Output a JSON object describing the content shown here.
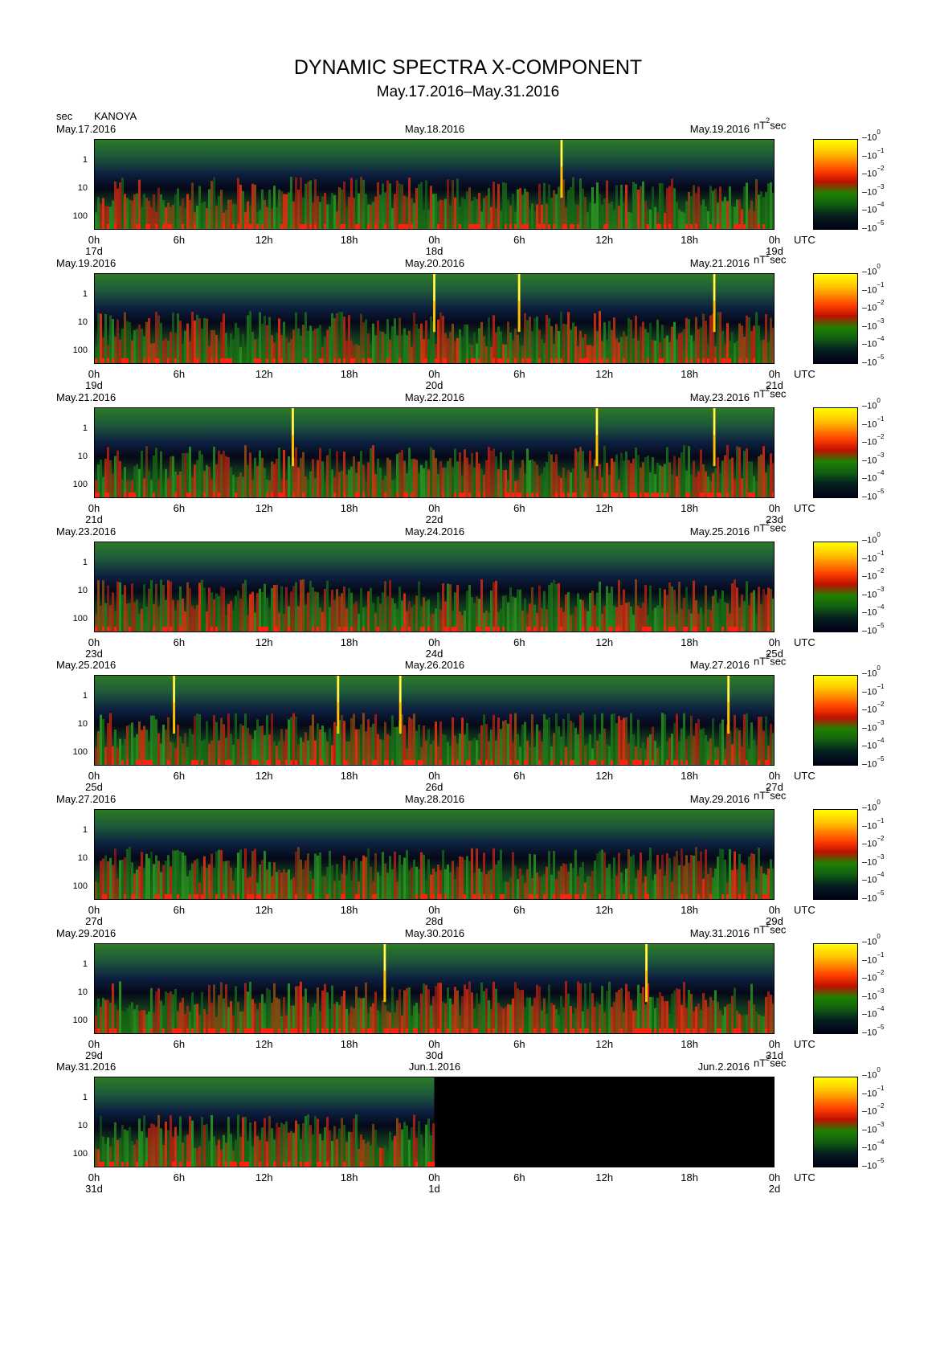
{
  "chart_data": {
    "type": "heatmap",
    "title": "DYNAMIC SPECTRA X-COMPONENT",
    "subtitle": "May.17.2016–May.31.2016",
    "station": "KANOYA",
    "y_unit": "sec",
    "y_ticks": [
      "1",
      "10",
      "100"
    ],
    "x_ticks": [
      "0h",
      "6h",
      "12h",
      "18h",
      "0h",
      "6h",
      "12h",
      "18h",
      "0h"
    ],
    "x_unit": "UTC",
    "colorbar": {
      "unit": "nT",
      "unit_exp": "2",
      "unit_suffix": "sec",
      "base": "10",
      "exponents": [
        "0",
        "−1",
        "−2",
        "−3",
        "−4",
        "−5"
      ]
    },
    "panels": [
      {
        "date_left": "May.17.2016",
        "date_mid": "May.18.2016",
        "date_right": "May.19.2016",
        "day_start": "17d",
        "day_mid": "18d",
        "day_end": "19d",
        "spikes_h": [
          33.0
        ],
        "data_end_h": 48
      },
      {
        "date_left": "May.19.2016",
        "date_mid": "May.20.2016",
        "date_right": "May.21.2016",
        "day_start": "19d",
        "day_mid": "20d",
        "day_end": "21d",
        "spikes_h": [
          24.0,
          30.0,
          43.8
        ],
        "data_end_h": 48
      },
      {
        "date_left": "May.21.2016",
        "date_mid": "May.22.2016",
        "date_right": "May.23.2016",
        "day_start": "21d",
        "day_mid": "22d",
        "day_end": "23d",
        "spikes_h": [
          14.0,
          35.5,
          43.8
        ],
        "data_end_h": 48
      },
      {
        "date_left": "May.23.2016",
        "date_mid": "May.24.2016",
        "date_right": "May.25.2016",
        "day_start": "23d",
        "day_mid": "24d",
        "day_end": "25d",
        "spikes_h": [],
        "data_end_h": 48
      },
      {
        "date_left": "May.25.2016",
        "date_mid": "May.26.2016",
        "date_right": "May.27.2016",
        "day_start": "25d",
        "day_mid": "26d",
        "day_end": "27d",
        "spikes_h": [
          5.6,
          17.2,
          21.6,
          44.8
        ],
        "data_end_h": 48
      },
      {
        "date_left": "May.27.2016",
        "date_mid": "May.28.2016",
        "date_right": "May.29.2016",
        "day_start": "27d",
        "day_mid": "28d",
        "day_end": "29d",
        "spikes_h": [],
        "data_end_h": 48
      },
      {
        "date_left": "May.29.2016",
        "date_mid": "May.30.2016",
        "date_right": "May.31.2016",
        "day_start": "29d",
        "day_mid": "30d",
        "day_end": "31d",
        "spikes_h": [
          20.5,
          39.0
        ],
        "data_end_h": 48
      },
      {
        "date_left": "May.31.2016",
        "date_mid": "Jun.1.2016",
        "date_right": "Jun.2.2016",
        "day_start": "31d",
        "day_mid": "1d",
        "day_end": "2d",
        "spikes_h": [],
        "data_end_h": 24
      }
    ]
  }
}
